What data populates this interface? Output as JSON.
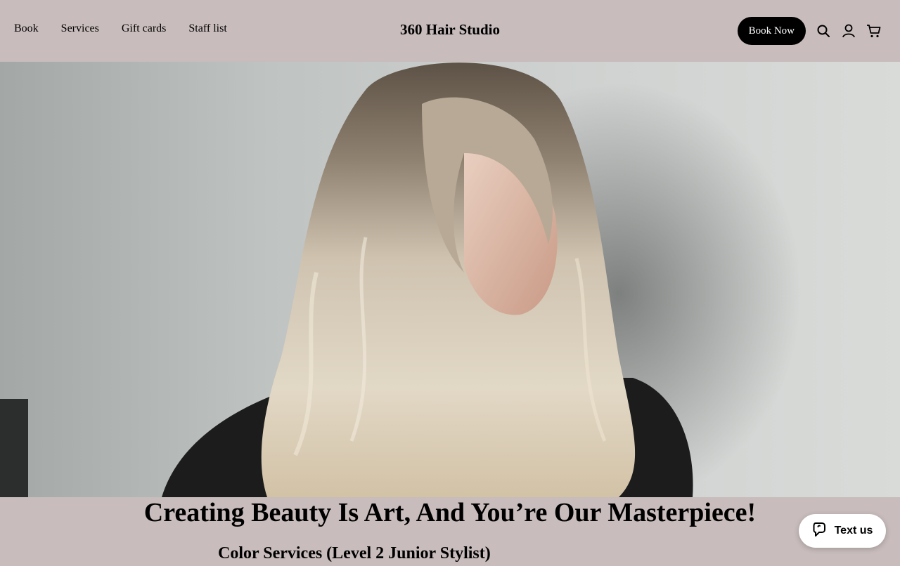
{
  "nav": {
    "items": [
      {
        "label": "Book"
      },
      {
        "label": "Services"
      },
      {
        "label": "Gift cards"
      },
      {
        "label": "Staff list"
      }
    ]
  },
  "brand": {
    "name": "360 Hair Studio"
  },
  "actions": {
    "book_now_label": "Book Now",
    "icons": [
      "search-icon",
      "account-icon",
      "cart-icon"
    ]
  },
  "hero": {
    "image_alt": "Woman with long blonde balayage waves"
  },
  "headline": "Creating Beauty Is Art, And You’re Our Masterpiece!",
  "subhead": "Color Services (Level 2 Junior Stylist)",
  "chat": {
    "label": "Text us"
  },
  "colors": {
    "background": "#c8bcbc",
    "button": "#000000"
  }
}
